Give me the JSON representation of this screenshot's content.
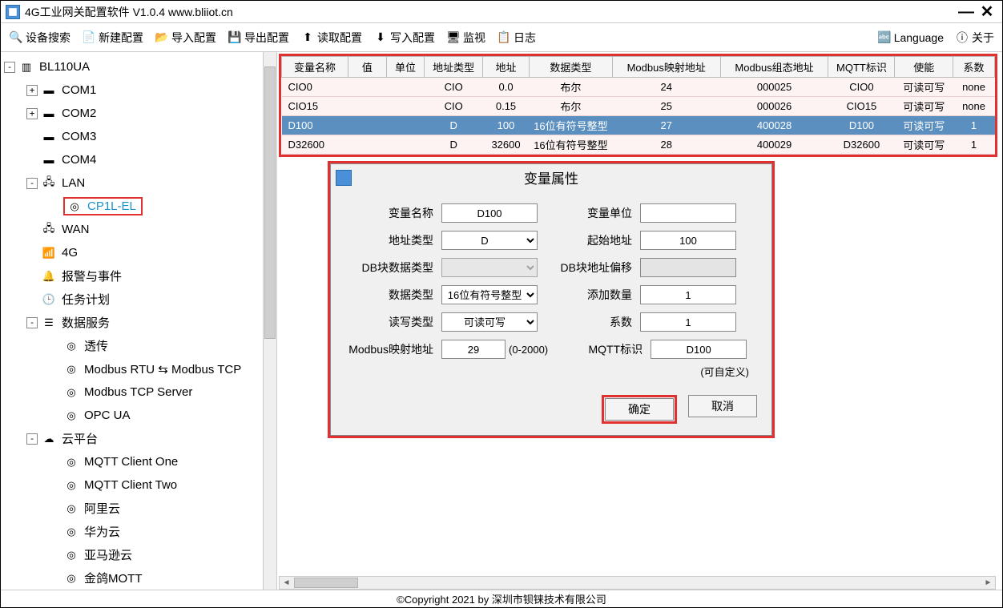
{
  "title": "4G工业网关配置软件 V1.0.4 www.bliiot.cn",
  "toolbar": {
    "search": "设备搜索",
    "new": "新建配置",
    "import": "导入配置",
    "export": "导出配置",
    "read": "读取配置",
    "write": "写入配置",
    "monitor": "监视",
    "log": "日志",
    "language": "Language",
    "about": "关于"
  },
  "tree": {
    "root": "BL110UA",
    "com1": "COM1",
    "com2": "COM2",
    "com3": "COM3",
    "com4": "COM4",
    "lan": "LAN",
    "cp1l": "CP1L-EL",
    "wan": "WAN",
    "g4": "4G",
    "alarm": "报警与事件",
    "task": "任务计划",
    "dataservice": "数据服务",
    "passthru": "透传",
    "modbus_rtu": "Modbus RTU ⇆ Modbus TCP",
    "modbus_tcp": "Modbus TCP Server",
    "opcua": "OPC UA",
    "cloud": "云平台",
    "mqtt1": "MQTT Client One",
    "mqtt2": "MQTT Client Two",
    "aliyun": "阿里云",
    "huawei": "华为云",
    "aws": "亚马逊云",
    "jinge": "金鸽MOTT"
  },
  "table": {
    "headers": {
      "name": "变量名称",
      "value": "值",
      "unit": "单位",
      "addrtype": "地址类型",
      "addr": "地址",
      "datatype": "数据类型",
      "mapaddr": "Modbus映射地址",
      "cfgaddr": "Modbus组态地址",
      "mqtt": "MQTT标识",
      "enable": "使能",
      "coef": "系数"
    },
    "rows": [
      {
        "name": "CIO0",
        "value": "",
        "unit": "",
        "addrtype": "CIO",
        "addr": "0.0",
        "datatype": "布尔",
        "mapaddr": "24",
        "cfgaddr": "000025",
        "mqtt": "CIO0",
        "enable": "可读可写",
        "coef": "none"
      },
      {
        "name": "CIO15",
        "value": "",
        "unit": "",
        "addrtype": "CIO",
        "addr": "0.15",
        "datatype": "布尔",
        "mapaddr": "25",
        "cfgaddr": "000026",
        "mqtt": "CIO15",
        "enable": "可读可写",
        "coef": "none"
      },
      {
        "name": "D100",
        "value": "",
        "unit": "",
        "addrtype": "D",
        "addr": "100",
        "datatype": "16位有符号整型",
        "mapaddr": "27",
        "cfgaddr": "400028",
        "mqtt": "D100",
        "enable": "可读可写",
        "coef": "1",
        "sel": true
      },
      {
        "name": "D32600",
        "value": "",
        "unit": "",
        "addrtype": "D",
        "addr": "32600",
        "datatype": "16位有符号整型",
        "mapaddr": "28",
        "cfgaddr": "400029",
        "mqtt": "D32600",
        "enable": "可读可写",
        "coef": "1"
      }
    ]
  },
  "dialog": {
    "title": "变量属性",
    "labels": {
      "name": "变量名称",
      "unit": "变量单位",
      "addrtype": "地址类型",
      "startaddr": "起始地址",
      "dbtype": "DB块数据类型",
      "dboffset": "DB块地址偏移",
      "datatype": "数据类型",
      "addcount": "添加数量",
      "rwtype": "读写类型",
      "coef": "系数",
      "mapaddr": "Modbus映射地址",
      "mqtt": "MQTT标识"
    },
    "values": {
      "name": "D100",
      "unit": "",
      "addrtype": "D",
      "startaddr": "100",
      "dbtype": "",
      "dboffset": "",
      "datatype": "16位有符号整型",
      "addcount": "1",
      "rwtype": "可读可写",
      "coef": "1",
      "mapaddr": "29",
      "mqtt": "D100"
    },
    "hints": {
      "maprange": "(0-2000)",
      "mqtthint": "(可自定义)"
    },
    "buttons": {
      "ok": "确定",
      "cancel": "取消"
    }
  },
  "footer": "©Copyright 2021 by 深圳市钡铼技术有限公司"
}
